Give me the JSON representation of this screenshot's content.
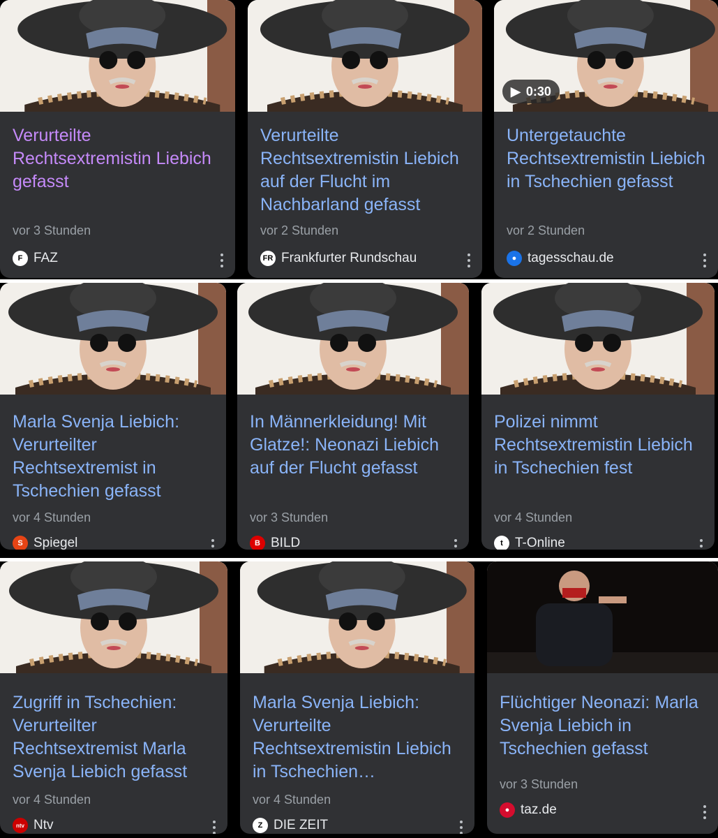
{
  "rows": [
    [
      {
        "title": "Verurteilte Rechtsextremistin Liebich gefasst",
        "time": "vor 3 Stunden",
        "source": "FAZ",
        "logo_text": "F",
        "logo_color": "#ffffff",
        "logo_fg": "#000000",
        "visited": true,
        "image": "person-hat-profile-icon"
      },
      {
        "title": "Verurteilte Rechtsextremistin Liebich auf der Flucht im Nachbarland gefasst",
        "time": "vor 2 Stunden",
        "source": "Frankfurter Rundschau",
        "logo_text": "FR",
        "logo_color": "#ffffff",
        "logo_fg": "#000000",
        "visited": false,
        "image": "person-hat-front-icon"
      },
      {
        "title": "Untergetauchte Rechtsextremistin Liebich in Tschechien gefasst",
        "time": "vor 2 Stunden",
        "source": "tagesschau.de",
        "logo_text": "●",
        "logo_color": "#1a73e8",
        "logo_fg": "#ffffff",
        "visited": false,
        "image": "person-hat-profile-icon",
        "duration": "0:30"
      }
    ],
    [
      {
        "title": "Marla Svenja Liebich: Verurteilter Rechtsextremist in Tschechien gefasst",
        "time": "vor 4 Stunden",
        "source": "Spiegel",
        "logo_text": "S",
        "logo_color": "#e64415",
        "logo_fg": "#ffffff",
        "visited": false,
        "image": "person-hat-front-icon"
      },
      {
        "title": "In Männerkleidung! Mit Glatze!: Neonazi Liebich auf der Flucht gefasst",
        "time": "vor 3 Stunden",
        "source": "BILD",
        "logo_text": "B",
        "logo_color": "#dd0000",
        "logo_fg": "#ffffff",
        "visited": false,
        "image": "person-hat-front-icon"
      },
      {
        "title": "Polizei nimmt Rechtsextremistin Liebich in Tschechien fest",
        "time": "vor 4 Stunden",
        "source": "T-Online",
        "logo_text": "t",
        "logo_color": "#ffffff",
        "logo_fg": "#000000",
        "visited": false,
        "image": "person-hat-front-icon"
      }
    ],
    [
      {
        "title": "Zugriff in Tschechien: Verurteilter Rechtsextremist Marla Svenja Liebich gefasst",
        "time": "vor 4 Stunden",
        "source": "Ntv",
        "logo_text": "ntv",
        "logo_color": "#cc0000",
        "logo_fg": "#ffffff",
        "visited": false,
        "image": "person-hat-front-icon"
      },
      {
        "title": "Marla Svenja Liebich: Verurteilte Rechtsextremistin Liebich in Tschechien…",
        "time": "vor 4 Stunden",
        "source": "DIE ZEIT",
        "logo_text": "Z",
        "logo_color": "#ffffff",
        "logo_fg": "#000000",
        "visited": false,
        "image": "person-hat-profile-icon"
      },
      {
        "title": "Flüchtiger Neonazi: Marla Svenja Liebich in Tschechien gefasst",
        "time": "vor 3 Stunden",
        "source": "taz.de",
        "logo_text": "●",
        "logo_color": "#d50d2e",
        "logo_fg": "#ffffff",
        "visited": false,
        "image": "person-on-stage-icon"
      }
    ]
  ]
}
